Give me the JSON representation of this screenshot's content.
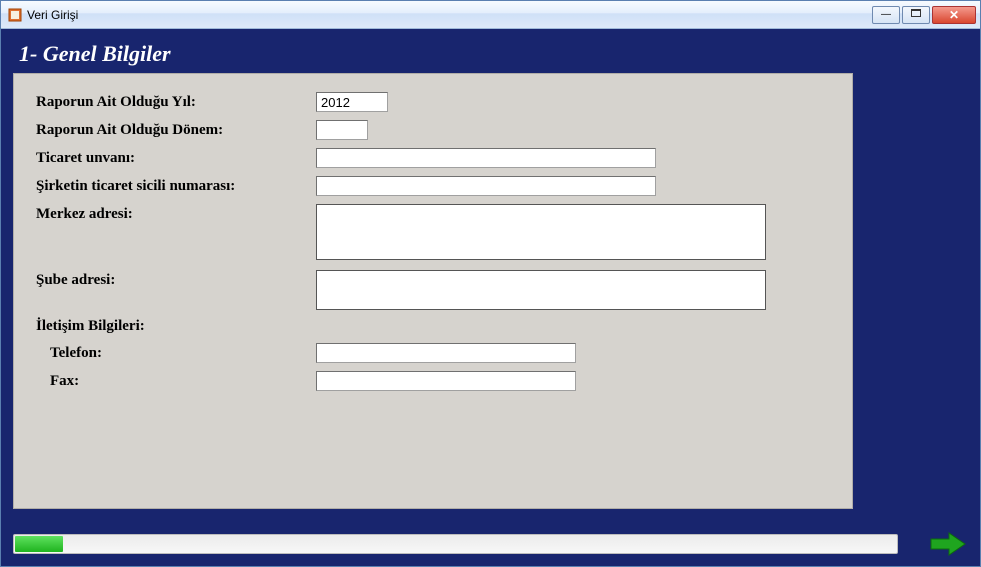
{
  "window": {
    "title": "Veri Girişi"
  },
  "section": {
    "title": "1- Genel Bilgiler"
  },
  "form": {
    "year_label": "Raporun Ait Olduğu Yıl:",
    "year_value": "2012",
    "period_label": "Raporun Ait Olduğu Dönem:",
    "period_value": "",
    "trade_name_label": "Ticaret unvanı:",
    "trade_name_value": "",
    "trade_registry_label": "Şirketin ticaret sicili numarası:",
    "trade_registry_value": "",
    "hq_address_label": "Merkez adresi:",
    "hq_address_value": "",
    "branch_address_label": "Şube adresi:",
    "branch_address_value": "",
    "contact_header": "İletişim Bilgileri:",
    "phone_label": "Telefon:",
    "phone_value": "",
    "fax_label": "Fax:",
    "fax_value": ""
  }
}
